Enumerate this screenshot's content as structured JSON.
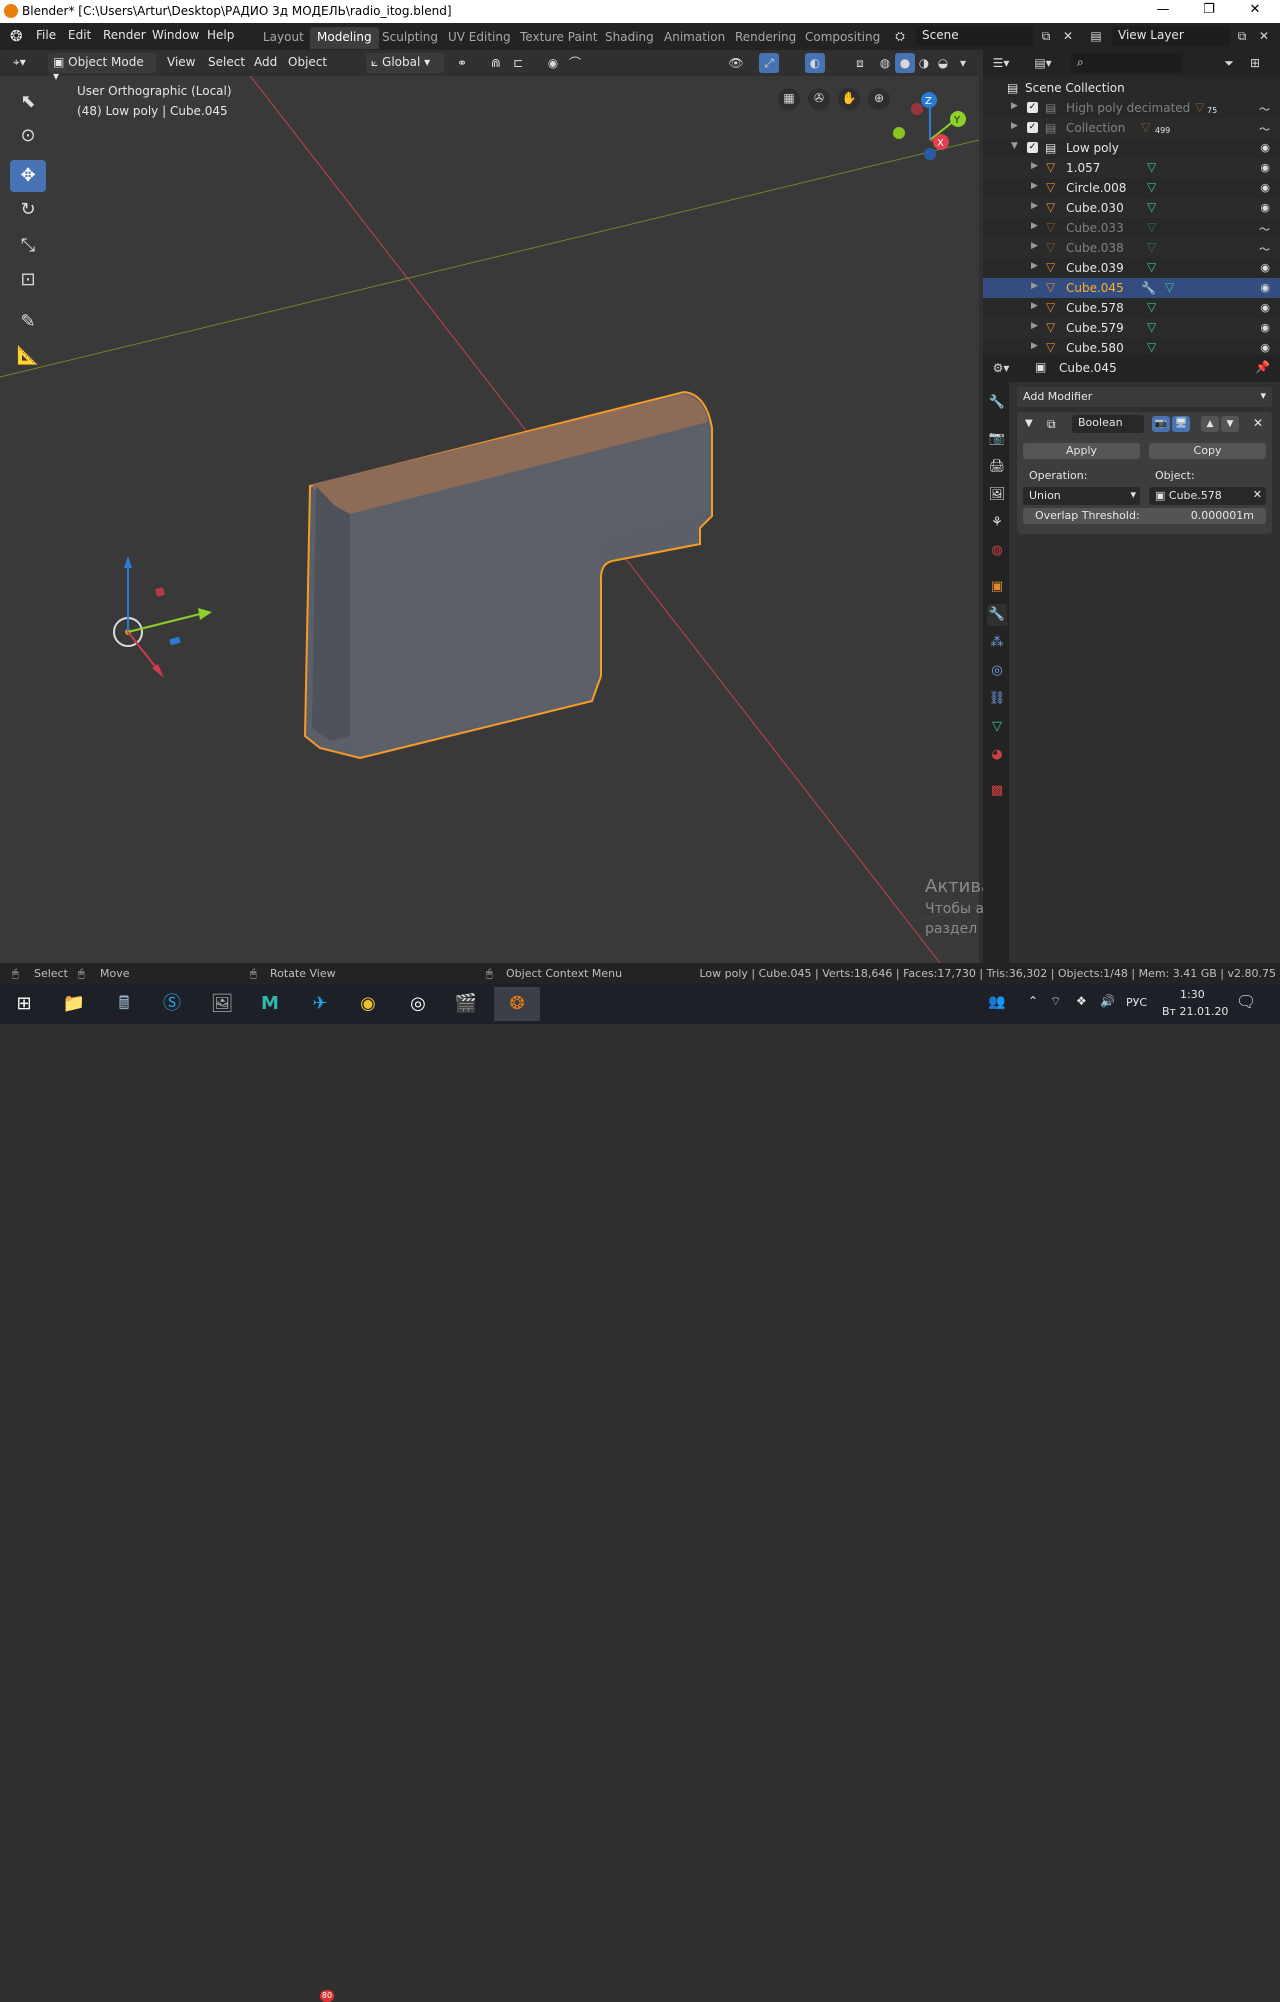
{
  "window": {
    "title": "Blender* [C:\\Users\\Artur\\Desktop\\РАДИО 3д МОДЕЛЬ\\radio_itog.blend]",
    "minimize": "—",
    "maximize": "❐",
    "close": "✕"
  },
  "menu": [
    "File",
    "Edit",
    "Render",
    "Window",
    "Help"
  ],
  "workspaces": [
    "Layout",
    "Modeling",
    "Sculpting",
    "UV Editing",
    "Texture Paint",
    "Shading",
    "Animation",
    "Rendering",
    "Compositing"
  ],
  "active_workspace": "Modeling",
  "scene_name": "Scene",
  "view_layer": "View Layer",
  "viewport_header": {
    "mode": "Object Mode",
    "view": "View",
    "select": "Select",
    "add": "Add",
    "object": "Object",
    "orientation": "Global"
  },
  "viewport": {
    "view_name": "User Orthographic (Local)",
    "info": "(48) Low poly | Cube.045"
  },
  "outliner": {
    "root": "Scene Collection",
    "rows": [
      {
        "name": "High poly decimated",
        "type": "collection",
        "dim": true,
        "badge": "75",
        "eye": "〜"
      },
      {
        "name": "Collection",
        "type": "collection",
        "dim": true,
        "badge": "499",
        "eye": "〜"
      },
      {
        "name": "Low poly",
        "type": "collection",
        "dim": false,
        "badge": "",
        "eye": "◉"
      },
      {
        "name": "1.057",
        "type": "mesh",
        "dim": false,
        "eye": "◉"
      },
      {
        "name": "Circle.008",
        "type": "mesh",
        "dim": false,
        "eye": "◉"
      },
      {
        "name": "Cube.030",
        "type": "mesh",
        "dim": false,
        "eye": "◉"
      },
      {
        "name": "Cube.033",
        "type": "mesh",
        "dim": true,
        "eye": "〜"
      },
      {
        "name": "Cube.038",
        "type": "mesh",
        "dim": true,
        "eye": "〜"
      },
      {
        "name": "Cube.039",
        "type": "mesh",
        "dim": false,
        "eye": "◉"
      },
      {
        "name": "Cube.045",
        "type": "mesh",
        "dim": false,
        "active": true,
        "eye": "◉"
      },
      {
        "name": "Cube.578",
        "type": "mesh",
        "dim": false,
        "eye": "◉"
      },
      {
        "name": "Cube.579",
        "type": "mesh",
        "dim": false,
        "eye": "◉"
      },
      {
        "name": "Cube.580",
        "type": "mesh",
        "dim": false,
        "eye": "◉"
      }
    ]
  },
  "properties": {
    "object_name": "Cube.045",
    "add_modifier": "Add Modifier",
    "modifier_name": "Boolean",
    "apply": "Apply",
    "copy": "Copy",
    "operation_label": "Operation:",
    "object_label": "Object:",
    "operation_value": "Union",
    "object_value": "Cube.578",
    "overlap_label": "Overlap Threshold:",
    "overlap_value": "0.000001m"
  },
  "statusbar": {
    "select": "Select",
    "move": "Move",
    "rotate": "Rotate View",
    "context": "Object Context Menu",
    "stats": "Low poly | Cube.045 | Verts:18,646 | Faces:17,730 | Tris:36,302 | Objects:1/48 | Mem: 3.41 GB | v2.80.75"
  },
  "watermark": {
    "title": "Активация Windows",
    "line1": "Чтобы активировать Windows, перейдите в",
    "line2": "раздел \"Параметры\"."
  },
  "taskbar": {
    "badge": "80",
    "lang": "РУС",
    "time": "1:30",
    "date": "Вт 21.01.20"
  },
  "colors": {
    "accent": "#4772b3",
    "selection_outline": "#f59b2a",
    "active_text": "#ffaf29"
  }
}
